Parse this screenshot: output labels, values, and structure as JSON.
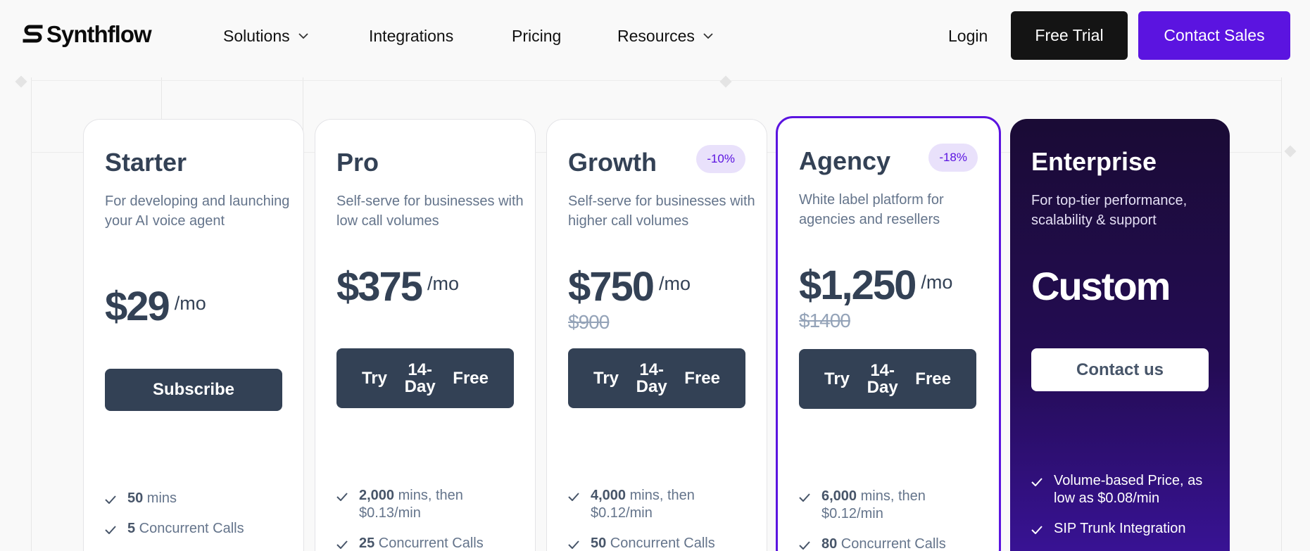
{
  "header": {
    "logo_text": "Synthflow",
    "nav": [
      {
        "label": "Solutions",
        "has_dropdown": true
      },
      {
        "label": "Integrations",
        "has_dropdown": false
      },
      {
        "label": "Pricing",
        "has_dropdown": false
      },
      {
        "label": "Resources",
        "has_dropdown": true
      }
    ],
    "login_label": "Login",
    "free_trial_label": "Free Trial",
    "contact_sales_label": "Contact Sales"
  },
  "colors": {
    "brand_purple": "#5b14e0",
    "slate": "#334155",
    "muted": "#64748b"
  },
  "plans": [
    {
      "name": "Starter",
      "description": "For developing and launching your AI voice agent",
      "price": "$29",
      "per": "/mo",
      "cta": "Subscribe",
      "features": [
        {
          "bold": "50",
          "text": " mins"
        },
        {
          "bold": "5",
          "text": " Concurrent Calls"
        }
      ]
    },
    {
      "name": "Pro",
      "description": "Self-serve for businesses with low call volumes",
      "price": "$375",
      "per": "/mo",
      "cta_left": "Try",
      "cta_mid": "14-Day",
      "cta_right": "Free",
      "features": [
        {
          "bold": "2,000",
          "text": " mins, then $0.13/min"
        },
        {
          "bold": "25",
          "text": " Concurrent Calls"
        }
      ]
    },
    {
      "name": "Growth",
      "badge": "-10%",
      "description": "Self-serve for businesses with higher call volumes",
      "price": "$750",
      "per": "/mo",
      "old_price": "$900",
      "cta_left": "Try",
      "cta_mid": "14-Day",
      "cta_right": "Free",
      "features": [
        {
          "bold": "4,000",
          "text": " mins, then $0.12/min"
        },
        {
          "bold": "50",
          "text": " Concurrent Calls"
        }
      ]
    },
    {
      "name": "Agency",
      "badge": "-18%",
      "description": "White label platform for agencies and resellers",
      "price": "$1,250",
      "per": "/mo",
      "old_price": "$1400",
      "cta_left": "Try",
      "cta_mid": "14-Day",
      "cta_right": "Free",
      "features": [
        {
          "bold": "6,000",
          "text": " mins, then $0.12/min"
        },
        {
          "bold": "80",
          "text": " Concurrent Calls"
        }
      ]
    },
    {
      "name": "Enterprise",
      "description": "For top-tier performance, scalability & support",
      "price": "Custom",
      "cta": "Contact us",
      "features": [
        {
          "bold": "",
          "text": "Volume-based Price, as low as $0.08/min"
        },
        {
          "bold": "",
          "text": "SIP Trunk Integration"
        }
      ]
    }
  ]
}
